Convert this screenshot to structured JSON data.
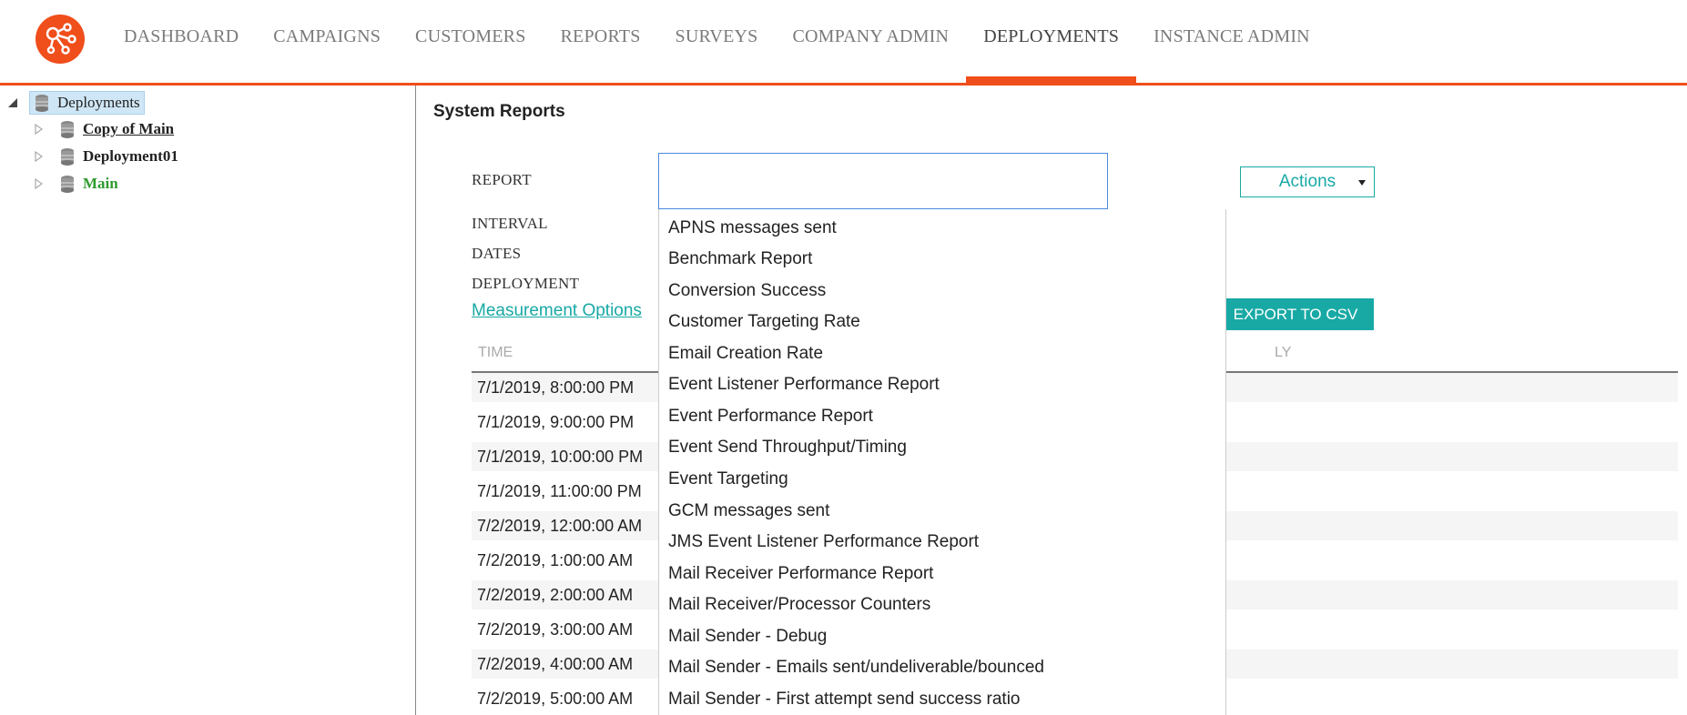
{
  "nav": {
    "items": [
      "DASHBOARD",
      "CAMPAIGNS",
      "CUSTOMERS",
      "REPORTS",
      "SURVEYS",
      "COMPANY ADMIN",
      "DEPLOYMENTS",
      "INSTANCE ADMIN"
    ],
    "active": "DEPLOYMENTS",
    "accent_color": "#f04e1b"
  },
  "tree": {
    "root": "Deployments",
    "children": [
      "Copy of Main",
      "Deployment01",
      "Main"
    ]
  },
  "main": {
    "title": "System Reports",
    "report_label": "REPORT",
    "report_value": "",
    "actions_label": "Actions",
    "interval_label": "INTERVAL",
    "dates_label": "DATES",
    "deployment_label": "DEPLOYMENT",
    "measurement_link": "Measurement Options",
    "export_label": "EXPORT TO CSV",
    "teal_color": "#18a9a5"
  },
  "table": {
    "columns": [
      "TIME",
      "LY"
    ],
    "rows": [
      "7/1/2019, 8:00:00 PM",
      "7/1/2019, 9:00:00 PM",
      "7/1/2019, 10:00:00 PM",
      "7/1/2019, 11:00:00 PM",
      "7/2/2019, 12:00:00 AM",
      "7/2/2019, 1:00:00 AM",
      "7/2/2019, 2:00:00 AM",
      "7/2/2019, 3:00:00 AM",
      "7/2/2019, 4:00:00 AM",
      "7/2/2019, 5:00:00 AM"
    ]
  },
  "dropdown": {
    "options": [
      "APNS messages sent",
      "Benchmark Report",
      "Conversion Success",
      "Customer Targeting Rate",
      "Email Creation Rate",
      "Event Listener Performance Report",
      "Event Performance Report",
      "Event Send Throughput/Timing",
      "Event Targeting",
      "GCM messages sent",
      "JMS Event Listener Performance Report",
      "Mail Receiver Performance Report",
      "Mail Receiver/Processor Counters",
      "Mail Sender - Debug",
      "Mail Sender - Emails sent/undeliverable/bounced",
      "Mail Sender - First attempt send success ratio"
    ]
  }
}
